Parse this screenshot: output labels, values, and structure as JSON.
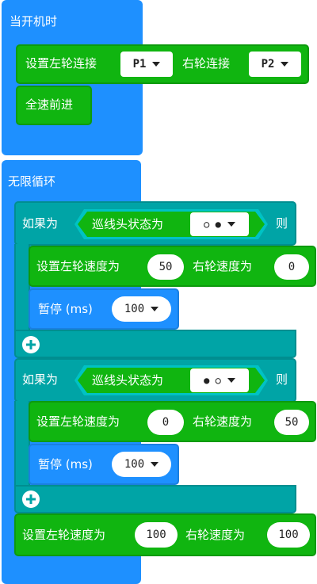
{
  "on_start": {
    "hat": "当开机时",
    "set_wheels": {
      "label_left": "设置左轮连接",
      "left_value": "P1",
      "label_right": "右轮连接",
      "right_value": "P2"
    },
    "forward": "全速前进"
  },
  "forever": {
    "hat": "无限循环",
    "if1": {
      "if_label": "如果为",
      "sensor_label": "巡线头状态为",
      "sensor_value": "○ ●",
      "then_label": "则",
      "set_speed": {
        "label_left": "设置左轮速度为",
        "left_value": "50",
        "label_right": "右轮速度为",
        "right_value": "0"
      },
      "pause": {
        "label": "暂停 (ms)",
        "value": "100"
      }
    },
    "if2": {
      "if_label": "如果为",
      "sensor_label": "巡线头状态为",
      "sensor_value": "● ○",
      "then_label": "则",
      "set_speed": {
        "label_left": "设置左轮速度为",
        "left_value": "0",
        "label_right": "右轮速度为",
        "right_value": "50"
      },
      "pause": {
        "label": "暂停 (ms)",
        "value": "100"
      }
    },
    "final_speed": {
      "label_left": "设置左轮速度为",
      "left_value": "100",
      "label_right": "右轮速度为",
      "right_value": "100"
    }
  },
  "colors": {
    "event_blue": "#1e90ff",
    "block_green": "#10b510",
    "logic_teal": "#00a4a6"
  },
  "icons": {
    "add_else": "plus-icon",
    "dropdown": "caret-down-icon"
  }
}
